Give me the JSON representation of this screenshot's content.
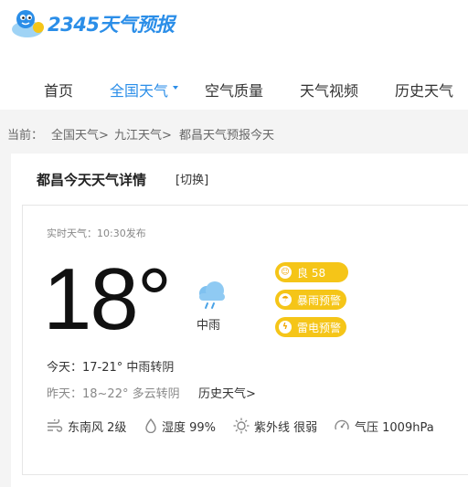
{
  "logo": {
    "brand": "2345天气预报"
  },
  "nav": {
    "items": [
      "首页",
      "全国天气",
      "空气质量",
      "天气视频",
      "历史天气"
    ],
    "active_index": 1
  },
  "breadcrumb": {
    "prefix": "当前：",
    "path": [
      "全国天气>",
      "九江天气>",
      "都昌天气预报今天"
    ]
  },
  "card": {
    "title": "都昌今天天气详情",
    "switch_label": "[切换]"
  },
  "realtime": {
    "label": "实时天气：10:30发布",
    "temperature": "18°",
    "condition": "中雨",
    "badges": [
      "良 58",
      "暴雨预警",
      "雷电预警"
    ],
    "today": "今天：17-21° 中雨转阴",
    "yesterday": "昨天：18~22° 多云转阴",
    "history_link": "历史天气>"
  },
  "stats": {
    "wind": "东南风 2级",
    "humidity": "湿度 99%",
    "uv": "紫外线 很弱",
    "pressure": "气压 1009hPa"
  },
  "colors": {
    "accent": "#2b8ee8",
    "badge": "#f5c518"
  },
  "icons": {
    "weather": "rain-cloud-icon",
    "wind": "wind-icon",
    "humidity": "droplet-icon",
    "uv": "sun-icon",
    "pressure": "gauge-icon"
  }
}
